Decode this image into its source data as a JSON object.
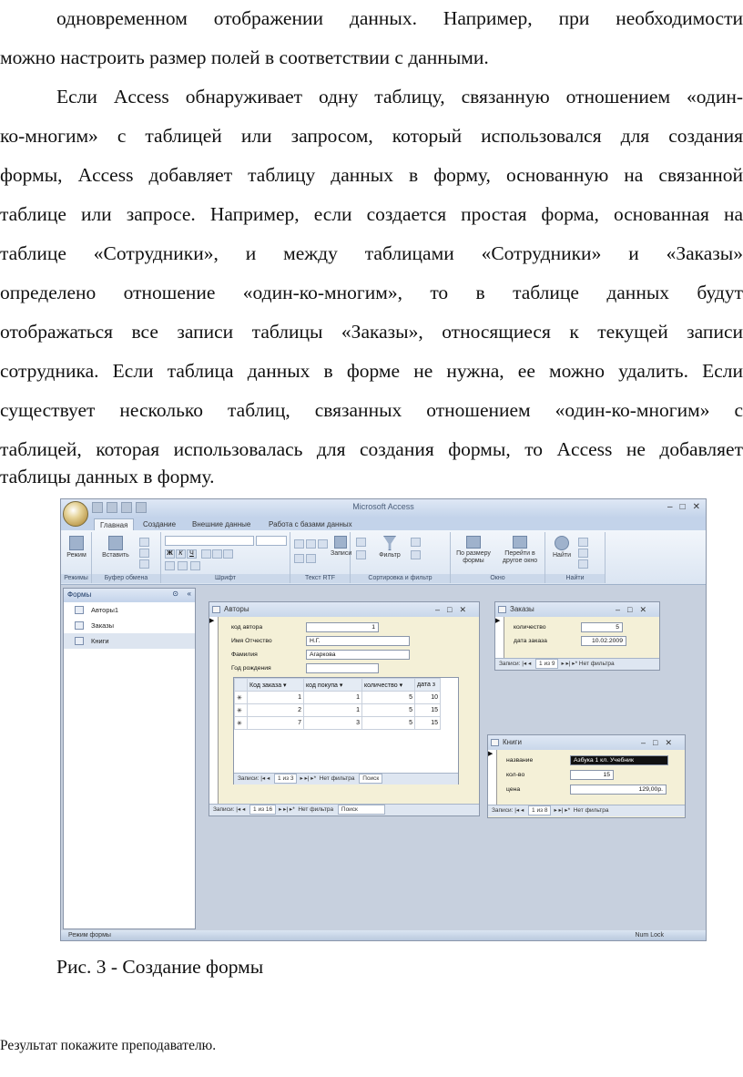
{
  "paragraph1": [
    "одновременном отображении данных. Например, при необходимости",
    "можно настроить размер полей в соответствии с данными."
  ],
  "paragraph2": [
    "Если Access обнаруживает одну таблицу, связанную отношением «один-",
    "ко-многим» с таблицей или запросом, который использовался для создания",
    "формы, Access добавляет таблицу данных в форму, основанную на связанной",
    "таблице или запросе. Например, если создается простая форма, основанная на",
    "таблице «Сотрудники», и между таблицами «Сотрудники» и «Заказы»",
    "определено отношение «один-ко-многим», то в таблице данных будут",
    "отображаться все записи таблицы «Заказы», относящиеся к текущей записи",
    "сотрудника. Если таблица данных в форме не нужна, ее можно удалить. Если",
    "существует несколько таблиц, связанных отношением «один-ко-многим» с",
    "таблицей, которая использовалась для создания формы, то Access не добавляет",
    "таблицы данных в форму."
  ],
  "screenshot": {
    "app_title": "Microsoft Access",
    "tabs": [
      "Главная",
      "Создание",
      "Внешние данные",
      "Работа с базами данных"
    ],
    "ribbon": {
      "modes_btn": "Режим",
      "paste_btn": "Вставить",
      "records_btn": "Записи",
      "filter_btn": "Фильтр",
      "fit_form_btn": [
        "По размеру",
        "формы"
      ],
      "switch_window_btn": [
        "Перейти в",
        "другое окно"
      ],
      "find_btn": "Найти",
      "bold": "Ж",
      "italic": "К",
      "underline": "Ч",
      "groups": [
        "Режимы",
        "Буфер обмена",
        "Шрифт",
        "Текст RTF",
        "Сортировка и фильтр",
        "Окно",
        "Найти"
      ]
    },
    "nav_pane": {
      "header": "Формы",
      "items": [
        "Авторы1",
        "Заказы",
        "Книги"
      ]
    },
    "form_authors": {
      "title": "Авторы",
      "fields": [
        {
          "label": "код автора",
          "value": "1"
        },
        {
          "label": "Имя Отчество",
          "value": "Н.Г."
        },
        {
          "label": "Фамилия",
          "value": "Агаркова"
        },
        {
          "label": "Год рождения",
          "value": ""
        }
      ],
      "subform": {
        "columns": [
          "Код заказа",
          "код покупа",
          "количество",
          "дата з"
        ],
        "rows": [
          [
            "1",
            "1",
            "5",
            "10"
          ],
          [
            "2",
            "1",
            "5",
            "15"
          ],
          [
            "7",
            "3",
            "5",
            "15"
          ]
        ],
        "navbar": {
          "label": "Записи:",
          "pos": "1 из 3",
          "filter": "Нет фильтра",
          "search": "Поиск"
        }
      },
      "navbar": {
        "label": "Записи:",
        "pos": "1 из 16",
        "filter": "Нет фильтра",
        "search": "Поиск"
      }
    },
    "form_orders": {
      "title": "Заказы",
      "fields": [
        {
          "label": "количество",
          "value": "5"
        },
        {
          "label": "дата заказа",
          "value": "10.02.2009"
        }
      ],
      "navbar": {
        "label": "Записи:",
        "pos": "1 из 9",
        "filter": "Нет фильтра"
      }
    },
    "form_books": {
      "title": "Книги",
      "fields": [
        {
          "label": "название",
          "value": "Азбука 1 кл. Учебник"
        },
        {
          "label": "кол-во",
          "value": "15"
        },
        {
          "label": "цена",
          "value": "129,00р."
        }
      ],
      "navbar": {
        "label": "Записи:",
        "pos": "1 из 8",
        "filter": "Нет фильтра"
      }
    },
    "status": {
      "left": "Режим формы",
      "right": "Num Lock"
    }
  },
  "caption": "Рис. 3 - Создание формы",
  "note": "Результат покажите преподавателю."
}
